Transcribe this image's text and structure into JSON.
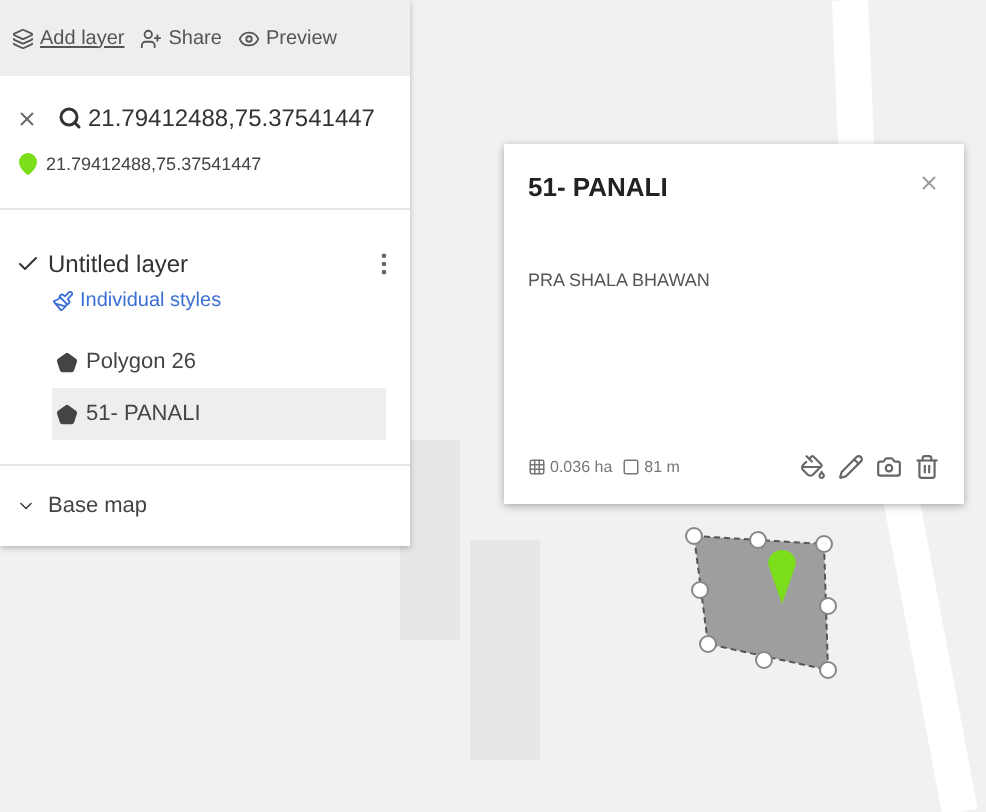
{
  "toolbar": [
    {
      "kind": "add_layer",
      "label": "Add layer"
    },
    {
      "kind": "share",
      "label": "Share"
    },
    {
      "kind": "preview",
      "label": "Preview"
    }
  ],
  "search": {
    "value": "21.79412488,75.37541447",
    "result": "21.79412488,75.37541447"
  },
  "layer": {
    "title": "Untitled layer",
    "checked": true,
    "style_link": "Individual styles",
    "items": [
      {
        "label": "Polygon 26",
        "selected": false
      },
      {
        "label": "51- PANALI",
        "selected": true
      }
    ]
  },
  "base_map": {
    "label": "Base map",
    "expanded": false
  },
  "popup": {
    "title": "51- PANALI",
    "description": "PRA SHALA BHAWAN",
    "area": "0.036 ha",
    "perimeter": "81 m"
  }
}
